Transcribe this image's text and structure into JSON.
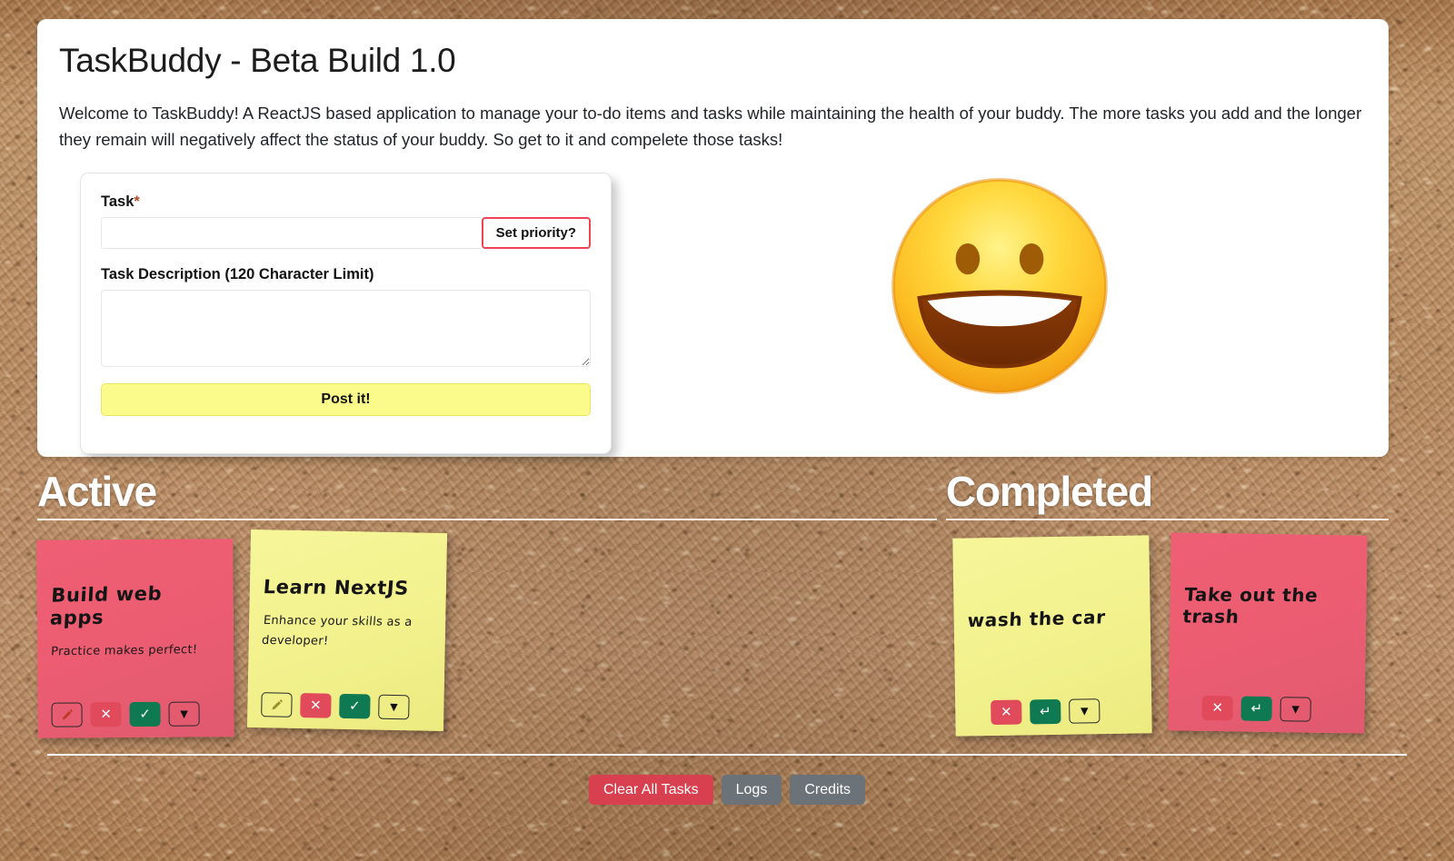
{
  "app": {
    "title": "TaskBuddy - Beta Build 1.0",
    "intro": "Welcome to TaskBuddy! A ReactJS based application to manage your to-do items and tasks while maintaining the health of your buddy. The more tasks you add and the longer they remain will negatively affect the status of your buddy. So get to it and compelete those tasks!"
  },
  "form": {
    "task_label": "Task",
    "task_required_marker": "*",
    "task_value": "",
    "task_placeholder": "",
    "priority_button": "Set priority?",
    "description_label": "Task Description (120 Character Limit)",
    "description_value": "",
    "description_placeholder": "",
    "submit_button": "Post it!"
  },
  "buddy": {
    "emoji_name": "grinning-face-emoji",
    "mood": "happy"
  },
  "columns": {
    "active": {
      "heading": "Active",
      "notes": [
        {
          "title": "Build web apps",
          "description": "Practice makes perfect!",
          "color": "red",
          "actions": [
            "edit",
            "delete",
            "complete",
            "more"
          ]
        },
        {
          "title": "Learn NextJS",
          "description": "Enhance your skills as a developer!",
          "color": "yellow",
          "actions": [
            "edit",
            "delete",
            "complete",
            "more"
          ]
        }
      ]
    },
    "completed": {
      "heading": "Completed",
      "notes": [
        {
          "title": "wash the car",
          "description": "",
          "color": "yellow",
          "actions": [
            "delete",
            "undo",
            "more"
          ]
        },
        {
          "title": "Take out the trash",
          "description": "",
          "color": "red",
          "actions": [
            "delete",
            "undo",
            "more"
          ]
        }
      ]
    }
  },
  "footer": {
    "clear_all": "Clear All Tasks",
    "logs": "Logs",
    "credits": "Credits"
  },
  "colors": {
    "note_red": "#ed5d72",
    "note_yellow": "#f3f28f",
    "accent_red": "#ef4255",
    "post_yellow": "#fbfb8c",
    "done_green": "#0f7a52",
    "danger": "#d9404f",
    "secondary": "#6b7278",
    "cork": "#bb9169"
  }
}
